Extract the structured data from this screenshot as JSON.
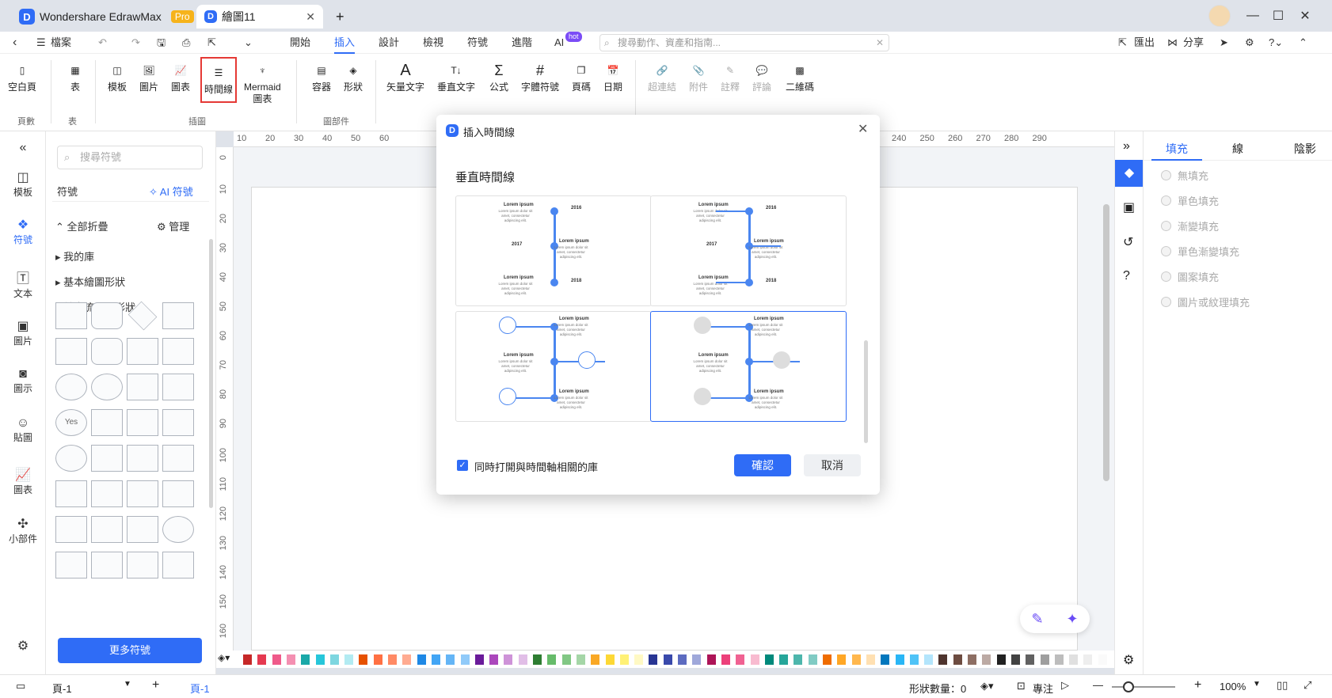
{
  "titlebar": {
    "app_name": "Wondershare EdrawMax",
    "pro_badge": "Pro",
    "doc_tab": "繪圖11",
    "new_tab": "+"
  },
  "menubar": {
    "file": "檔案",
    "tabs": [
      "開始",
      "插入",
      "設計",
      "檢視",
      "符號",
      "進階",
      "AI"
    ],
    "ai_badge": "hot",
    "search_placeholder": "搜尋動作、資產和指南...",
    "export": "匯出",
    "share": "分享"
  },
  "ribbon": {
    "buttons": [
      "空白頁",
      "表",
      "模板",
      "圖片",
      "圖表",
      "時間線",
      "Mermaid\n圖表",
      "容器",
      "形狀",
      "矢量文字",
      "垂直文字",
      "公式",
      "字體符號",
      "頁碼",
      "日期",
      "超連結",
      "附件",
      "註釋",
      "評論",
      "二維碼"
    ],
    "groups": [
      "頁數",
      "表",
      "插圖",
      "圖部件"
    ]
  },
  "rail": {
    "items": [
      "模板",
      "符號",
      "文本",
      "圖片",
      "圖示",
      "貼圖",
      "圖表",
      "小部件"
    ]
  },
  "library": {
    "search_placeholder": "搜尋符號",
    "symbols_label": "符號",
    "ai_symbols": "AI 符號",
    "collapse_all": "全部折疊",
    "manage": "管理",
    "categories": [
      "我的庫",
      "基本繪圖形狀",
      "基本流程圖形狀"
    ],
    "more_symbols": "更多符號",
    "yes_label": "Yes"
  },
  "ruler": {
    "top": [
      "10",
      "20",
      "30",
      "40",
      "50",
      "60",
      "220",
      "230",
      "240",
      "250",
      "260",
      "270",
      "280",
      "290"
    ],
    "left": [
      "0",
      "10",
      "20",
      "30",
      "40",
      "50",
      "60",
      "70",
      "80",
      "90",
      "100",
      "110",
      "120",
      "130",
      "140",
      "150",
      "160"
    ]
  },
  "right_panel": {
    "tabs": [
      "填充",
      "線",
      "陰影"
    ],
    "fill_options": [
      "無填充",
      "單色填充",
      "漸變填充",
      "單色漸變填充",
      "圖案填充",
      "圖片或紋理填充"
    ]
  },
  "status": {
    "page_select": "頁-1",
    "page_tab": "頁-1",
    "shape_count": "形狀數量：0",
    "focus": "專注",
    "zoom": "100%"
  },
  "modal": {
    "title": "插入時間線",
    "section": "垂直時間線",
    "sample_title": "Lorem ipsum",
    "sample_body": "Lorem ipsum dolor sit amet, consectetur adipiscing elit.",
    "years": [
      "2016",
      "2017",
      "2018"
    ],
    "checkbox_label": "同時打開與時間軸相關的庫",
    "ok": "確認",
    "cancel": "取消"
  },
  "colors": {
    "accent": "#2f6cf6",
    "timeline": "#4a86f0"
  }
}
